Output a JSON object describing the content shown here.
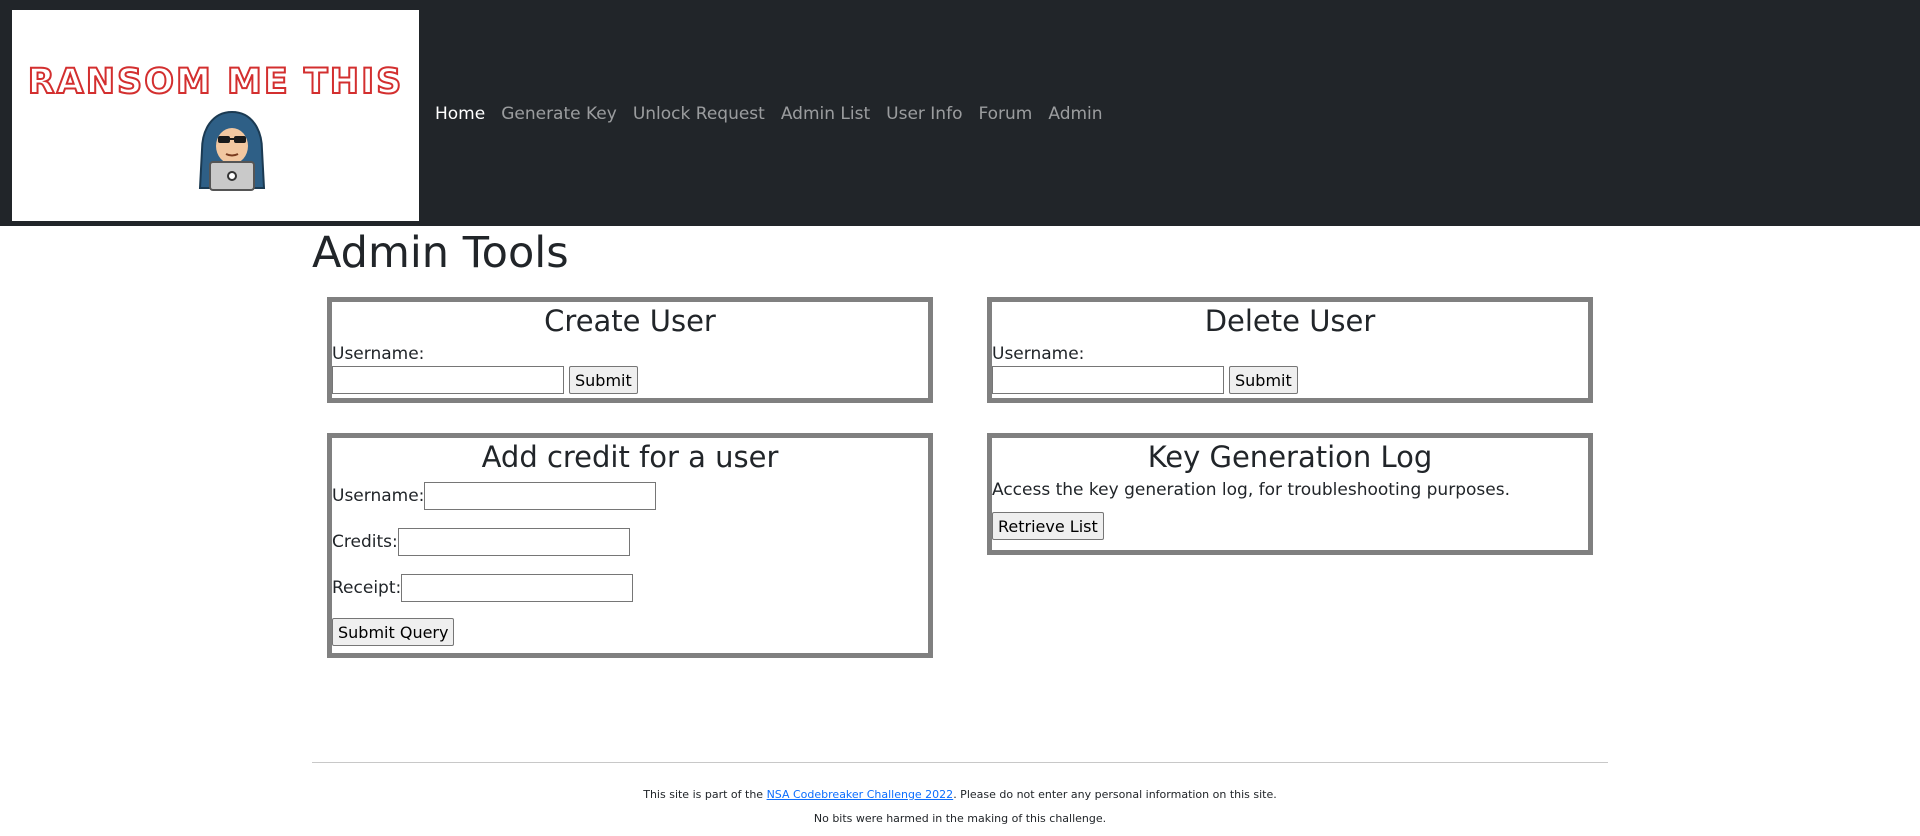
{
  "header": {
    "logo_text": "RANSOM ME THIS",
    "nav": [
      {
        "label": "Home",
        "active": true
      },
      {
        "label": "Generate Key"
      },
      {
        "label": "Unlock Request"
      },
      {
        "label": "Admin List"
      },
      {
        "label": "User Info"
      },
      {
        "label": "Forum"
      },
      {
        "label": "Admin"
      }
    ]
  },
  "main": {
    "title": "Admin Tools",
    "create_user": {
      "title": "Create User",
      "username_label": "Username:",
      "username_value": "",
      "submit_label": "Submit"
    },
    "delete_user": {
      "title": "Delete User",
      "username_label": "Username:",
      "username_value": "",
      "submit_label": "Submit"
    },
    "add_credit": {
      "title": "Add credit for a user",
      "username_label": "Username:",
      "credits_label": "Credits:",
      "receipt_label": "Receipt:",
      "username_value": "",
      "credits_value": "",
      "receipt_value": "",
      "submit_label": "Submit Query"
    },
    "key_log": {
      "title": "Key Generation Log",
      "description": "Access the key generation log, for troubleshooting purposes.",
      "button_label": "Retrieve List"
    }
  },
  "footer": {
    "line1_prefix": "This site is part of the ",
    "line1_link": "NSA Codebreaker Challenge 2022",
    "line1_suffix": ". Please do not enter any personal information on this site.",
    "line2": "No bits were harmed in the making of this challenge."
  },
  "colors": {
    "navbar_bg": "#212529",
    "logo_red": "#d32f2f",
    "card_border": "#808080",
    "link": "#0d6efd"
  }
}
